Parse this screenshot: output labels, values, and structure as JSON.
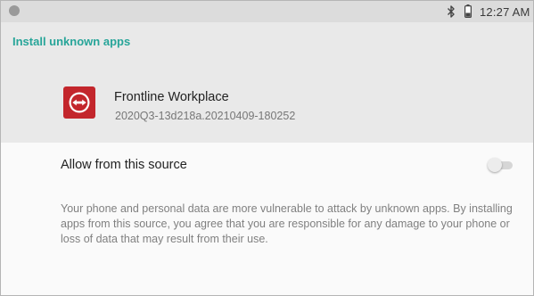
{
  "status_bar": {
    "time": "12:27 AM",
    "icons": [
      "status-dot-icon",
      "bluetooth-icon",
      "battery-icon"
    ]
  },
  "header": {
    "title": "Install unknown apps"
  },
  "app": {
    "name": "Frontline Workplace",
    "version": "2020Q3-13d218a.20210409-180252",
    "icon": "teamviewer-logo-icon",
    "icon_color": "#c3262c"
  },
  "settings": {
    "allow_label": "Allow from this source",
    "allow_enabled": false,
    "warning": "Your phone and personal data are more vulnerable to attack by unknown apps. By installing apps from this source, you agree that you are responsible for any damage to your phone or loss of data that may result from their use."
  },
  "colors": {
    "accent": "#27a599",
    "status_bar_bg": "#dcdcdc",
    "header_bg": "#e9e9e9",
    "page_bg": "#fafafa"
  }
}
